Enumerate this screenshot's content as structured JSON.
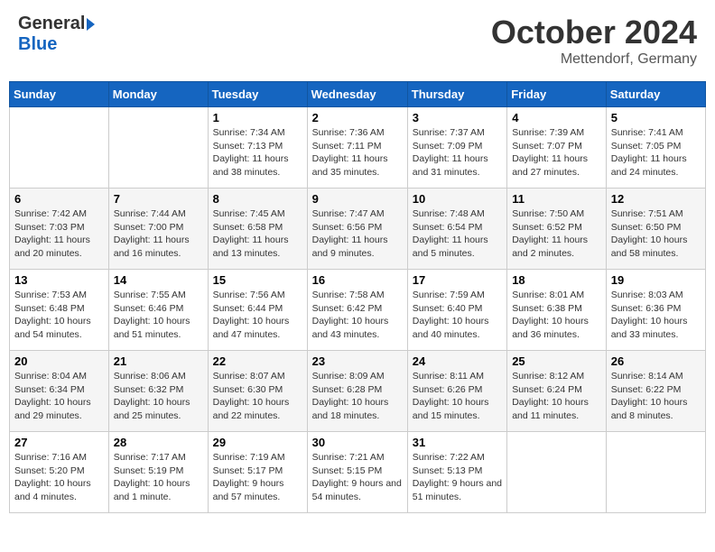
{
  "header": {
    "logo_general": "General",
    "logo_blue": "Blue",
    "month_title": "October 2024",
    "location": "Mettendorf, Germany"
  },
  "days_of_week": [
    "Sunday",
    "Monday",
    "Tuesday",
    "Wednesday",
    "Thursday",
    "Friday",
    "Saturday"
  ],
  "weeks": [
    [
      {
        "day": "",
        "info": ""
      },
      {
        "day": "",
        "info": ""
      },
      {
        "day": "1",
        "info": "Sunrise: 7:34 AM\nSunset: 7:13 PM\nDaylight: 11 hours and 38 minutes."
      },
      {
        "day": "2",
        "info": "Sunrise: 7:36 AM\nSunset: 7:11 PM\nDaylight: 11 hours and 35 minutes."
      },
      {
        "day": "3",
        "info": "Sunrise: 7:37 AM\nSunset: 7:09 PM\nDaylight: 11 hours and 31 minutes."
      },
      {
        "day": "4",
        "info": "Sunrise: 7:39 AM\nSunset: 7:07 PM\nDaylight: 11 hours and 27 minutes."
      },
      {
        "day": "5",
        "info": "Sunrise: 7:41 AM\nSunset: 7:05 PM\nDaylight: 11 hours and 24 minutes."
      }
    ],
    [
      {
        "day": "6",
        "info": "Sunrise: 7:42 AM\nSunset: 7:03 PM\nDaylight: 11 hours and 20 minutes."
      },
      {
        "day": "7",
        "info": "Sunrise: 7:44 AM\nSunset: 7:00 PM\nDaylight: 11 hours and 16 minutes."
      },
      {
        "day": "8",
        "info": "Sunrise: 7:45 AM\nSunset: 6:58 PM\nDaylight: 11 hours and 13 minutes."
      },
      {
        "day": "9",
        "info": "Sunrise: 7:47 AM\nSunset: 6:56 PM\nDaylight: 11 hours and 9 minutes."
      },
      {
        "day": "10",
        "info": "Sunrise: 7:48 AM\nSunset: 6:54 PM\nDaylight: 11 hours and 5 minutes."
      },
      {
        "day": "11",
        "info": "Sunrise: 7:50 AM\nSunset: 6:52 PM\nDaylight: 11 hours and 2 minutes."
      },
      {
        "day": "12",
        "info": "Sunrise: 7:51 AM\nSunset: 6:50 PM\nDaylight: 10 hours and 58 minutes."
      }
    ],
    [
      {
        "day": "13",
        "info": "Sunrise: 7:53 AM\nSunset: 6:48 PM\nDaylight: 10 hours and 54 minutes."
      },
      {
        "day": "14",
        "info": "Sunrise: 7:55 AM\nSunset: 6:46 PM\nDaylight: 10 hours and 51 minutes."
      },
      {
        "day": "15",
        "info": "Sunrise: 7:56 AM\nSunset: 6:44 PM\nDaylight: 10 hours and 47 minutes."
      },
      {
        "day": "16",
        "info": "Sunrise: 7:58 AM\nSunset: 6:42 PM\nDaylight: 10 hours and 43 minutes."
      },
      {
        "day": "17",
        "info": "Sunrise: 7:59 AM\nSunset: 6:40 PM\nDaylight: 10 hours and 40 minutes."
      },
      {
        "day": "18",
        "info": "Sunrise: 8:01 AM\nSunset: 6:38 PM\nDaylight: 10 hours and 36 minutes."
      },
      {
        "day": "19",
        "info": "Sunrise: 8:03 AM\nSunset: 6:36 PM\nDaylight: 10 hours and 33 minutes."
      }
    ],
    [
      {
        "day": "20",
        "info": "Sunrise: 8:04 AM\nSunset: 6:34 PM\nDaylight: 10 hours and 29 minutes."
      },
      {
        "day": "21",
        "info": "Sunrise: 8:06 AM\nSunset: 6:32 PM\nDaylight: 10 hours and 25 minutes."
      },
      {
        "day": "22",
        "info": "Sunrise: 8:07 AM\nSunset: 6:30 PM\nDaylight: 10 hours and 22 minutes."
      },
      {
        "day": "23",
        "info": "Sunrise: 8:09 AM\nSunset: 6:28 PM\nDaylight: 10 hours and 18 minutes."
      },
      {
        "day": "24",
        "info": "Sunrise: 8:11 AM\nSunset: 6:26 PM\nDaylight: 10 hours and 15 minutes."
      },
      {
        "day": "25",
        "info": "Sunrise: 8:12 AM\nSunset: 6:24 PM\nDaylight: 10 hours and 11 minutes."
      },
      {
        "day": "26",
        "info": "Sunrise: 8:14 AM\nSunset: 6:22 PM\nDaylight: 10 hours and 8 minutes."
      }
    ],
    [
      {
        "day": "27",
        "info": "Sunrise: 7:16 AM\nSunset: 5:20 PM\nDaylight: 10 hours and 4 minutes."
      },
      {
        "day": "28",
        "info": "Sunrise: 7:17 AM\nSunset: 5:19 PM\nDaylight: 10 hours and 1 minute."
      },
      {
        "day": "29",
        "info": "Sunrise: 7:19 AM\nSunset: 5:17 PM\nDaylight: 9 hours and 57 minutes."
      },
      {
        "day": "30",
        "info": "Sunrise: 7:21 AM\nSunset: 5:15 PM\nDaylight: 9 hours and 54 minutes."
      },
      {
        "day": "31",
        "info": "Sunrise: 7:22 AM\nSunset: 5:13 PM\nDaylight: 9 hours and 51 minutes."
      },
      {
        "day": "",
        "info": ""
      },
      {
        "day": "",
        "info": ""
      }
    ]
  ]
}
